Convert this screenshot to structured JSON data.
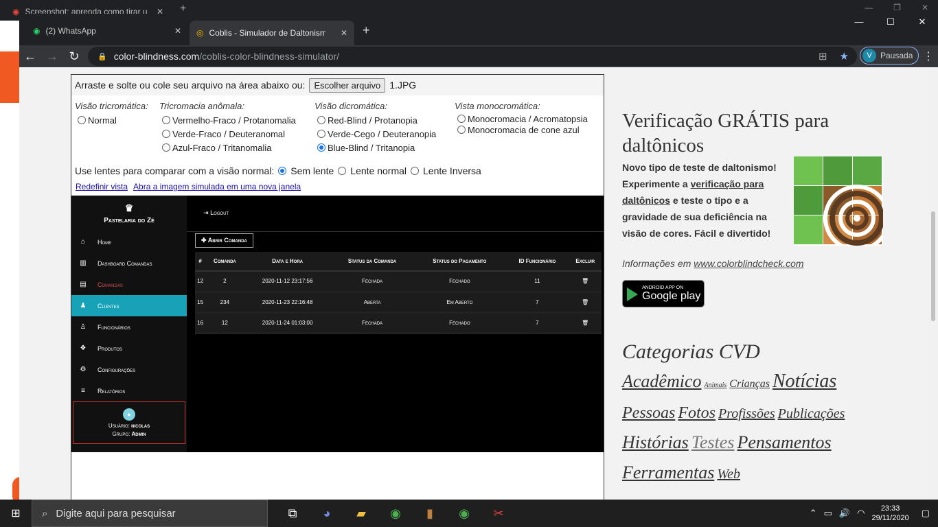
{
  "background_tab": {
    "title": "Screenshot: aprenda como tirar u"
  },
  "tabs": [
    {
      "label": "(2) WhatsApp"
    },
    {
      "label": "Coblis - Simulador de Daltonismo"
    }
  ],
  "url": {
    "host": "color-blindness.com",
    "path": "/coblis-color-blindness-simulator/"
  },
  "profile": {
    "initial": "V",
    "label": "Pausada"
  },
  "simulator": {
    "upload_text": "Arraste e solte ou cole seu arquivo na área abaixo ou:",
    "file_button": "Escolher arquivo",
    "file_name": "1.JPG",
    "groups": [
      {
        "heading": "Visão tricromática:",
        "options": [
          "Normal"
        ]
      },
      {
        "heading": "Tricromacia anômala:",
        "options": [
          "Vermelho-Fraco / Protanomalia",
          "Verde-Fraco / Deuteranomal",
          "Azul-Fraco / Tritanomalia"
        ]
      },
      {
        "heading": "Visão dicromática:",
        "options": [
          "Red-Blind / Protanopia",
          "Verde-Cego / Deuteranopia",
          "Blue-Blind / Tritanopia"
        ]
      },
      {
        "heading": "Vista monocromática:",
        "options": [
          "Monocromacia / Acromatopsia",
          "Monocromacia de cone azul"
        ]
      }
    ],
    "lens_label": "Use lentes para comparar com a visão normal:",
    "lens_options": [
      "Sem lente",
      "Lente normal",
      "Lente Inversa"
    ],
    "link_reset": "Redefinir vista",
    "link_open": "Abra a imagem simulada em uma nova janela"
  },
  "app": {
    "brand": "Pastelaria do Zé",
    "logout": "Logout",
    "menu": [
      "Home",
      "Dashboard Comandas",
      "Comandas",
      "Clientes",
      "Funcionários",
      "Produtos",
      "Configurações",
      "Relatórios"
    ],
    "user_label": "Usuário:",
    "user_name": "nicolas",
    "group_label": "Grupo:",
    "group_name": "Admin",
    "add_button": "Abrir Comanda",
    "columns": [
      "#",
      "Comanda",
      "Data e Hora",
      "Status da Comanda",
      "Status do Pagamento",
      "ID Funcionário",
      "Excluir"
    ],
    "rows": [
      [
        "12",
        "2",
        "2020-11-12 23:17:56",
        "Fechada",
        "Fechado",
        "11"
      ],
      [
        "15",
        "234",
        "2020-11-23 22:16:48",
        "Aberta",
        "Em Aberto",
        "7"
      ],
      [
        "16",
        "12",
        "2020-11-24 01:03:00",
        "Fechada",
        "Fechado",
        "7"
      ]
    ]
  },
  "sidebar_right": {
    "title": "Verificação GRÁTIS para daltônicos",
    "text1": "Novo tipo de teste de daltonismo! Experimente a ",
    "link": "verificação para daltônicos",
    "text2": " e teste o tipo e a gravidade de sua deficiência na visão de cores. Fácil e divertido!",
    "info": "Informações em ",
    "info_link": "www.colorblindcheck.com",
    "gplay_small": "ANDROID APP ON",
    "gplay_big": "Google play",
    "categories_title": "Categorias CVD",
    "tags": [
      "Acadêmico",
      "Animais",
      "Crianças",
      "Notícias",
      "Pessoas",
      "Fotos",
      "Profissões",
      "Publicações",
      "Histórias",
      "Testes",
      "Pensamentos",
      "Ferramentas",
      "Web"
    ]
  },
  "taskbar": {
    "search_placeholder": "Digite aqui para pesquisar",
    "time": "23:33",
    "date": "29/11/2020"
  }
}
